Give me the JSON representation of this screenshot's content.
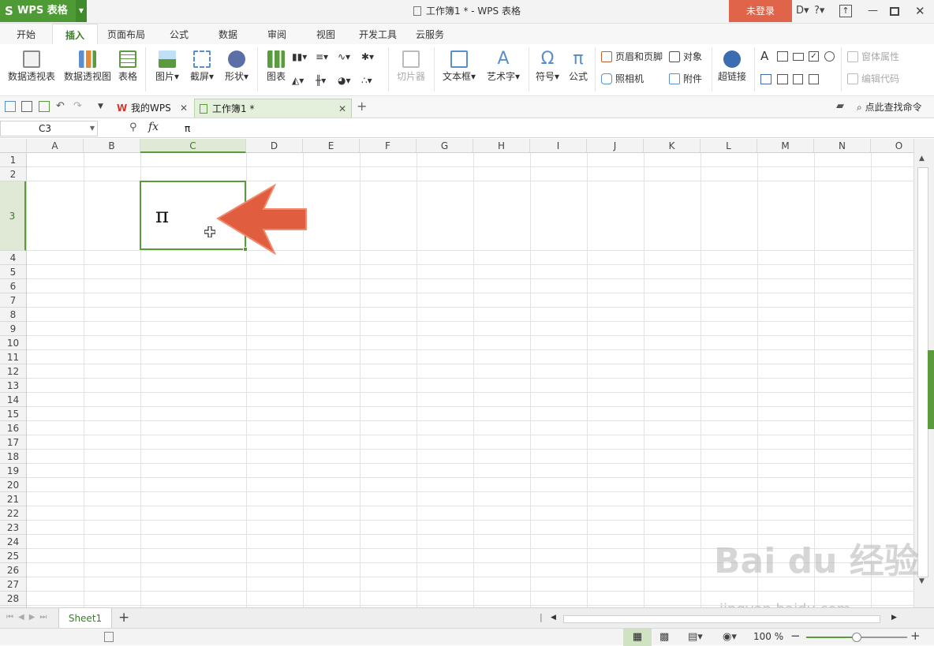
{
  "app": {
    "name": "WPS 表格",
    "window_title": "工作簿1 * - WPS 表格",
    "login_label": "未登录"
  },
  "menu_tabs": [
    {
      "label": "开始"
    },
    {
      "label": "插入",
      "active": true
    },
    {
      "label": "页面布局"
    },
    {
      "label": "公式"
    },
    {
      "label": "数据"
    },
    {
      "label": "审阅"
    },
    {
      "label": "视图"
    },
    {
      "label": "开发工具"
    },
    {
      "label": "云服务"
    }
  ],
  "ribbon": {
    "pivot_table": "数据透视表",
    "pivot_chart": "数据透视图",
    "table": "表格",
    "picture": "图片",
    "screenshot": "截屏",
    "shapes": "形状",
    "chart": "图表",
    "slicer": "切片器",
    "textbox": "文本框",
    "wordart": "艺术字",
    "symbol": "符号",
    "equation": "公式",
    "header_footer": "页眉和页脚",
    "camera": "照相机",
    "object": "对象",
    "attachment": "附件",
    "hyperlink": "超链接",
    "form_props": "窗体属性",
    "edit_code": "编辑代码"
  },
  "doc_tabs": [
    {
      "label": "我的WPS"
    },
    {
      "label": "工作簿1 *",
      "active": true
    }
  ],
  "search_command": "点此查找命令",
  "formula_bar": {
    "cell_ref": "C3",
    "fx": "fx",
    "content": "π"
  },
  "columns": [
    "A",
    "B",
    "C",
    "D",
    "E",
    "F",
    "G",
    "H",
    "I",
    "J",
    "K",
    "L",
    "M",
    "N",
    "O"
  ],
  "rows": [
    "1",
    "2",
    "3",
    "4",
    "5",
    "6",
    "7",
    "8",
    "9",
    "10",
    "11",
    "12",
    "13",
    "14",
    "15",
    "16",
    "17",
    "18",
    "19",
    "20",
    "21",
    "22",
    "23",
    "24",
    "25",
    "26",
    "27",
    "28"
  ],
  "selected": {
    "col": "C",
    "row": "3",
    "value": "π"
  },
  "sheet_tabs": [
    {
      "label": "Sheet1"
    }
  ],
  "status": {
    "zoom_label": "100 %",
    "zoom_value": 0.5
  },
  "watermark": {
    "brand": "Bai du 经验",
    "url": "jingyan.baidu.com"
  },
  "colors": {
    "accent": "#4e9a35",
    "login": "#e0644a",
    "arrow": "#e05d3f"
  }
}
